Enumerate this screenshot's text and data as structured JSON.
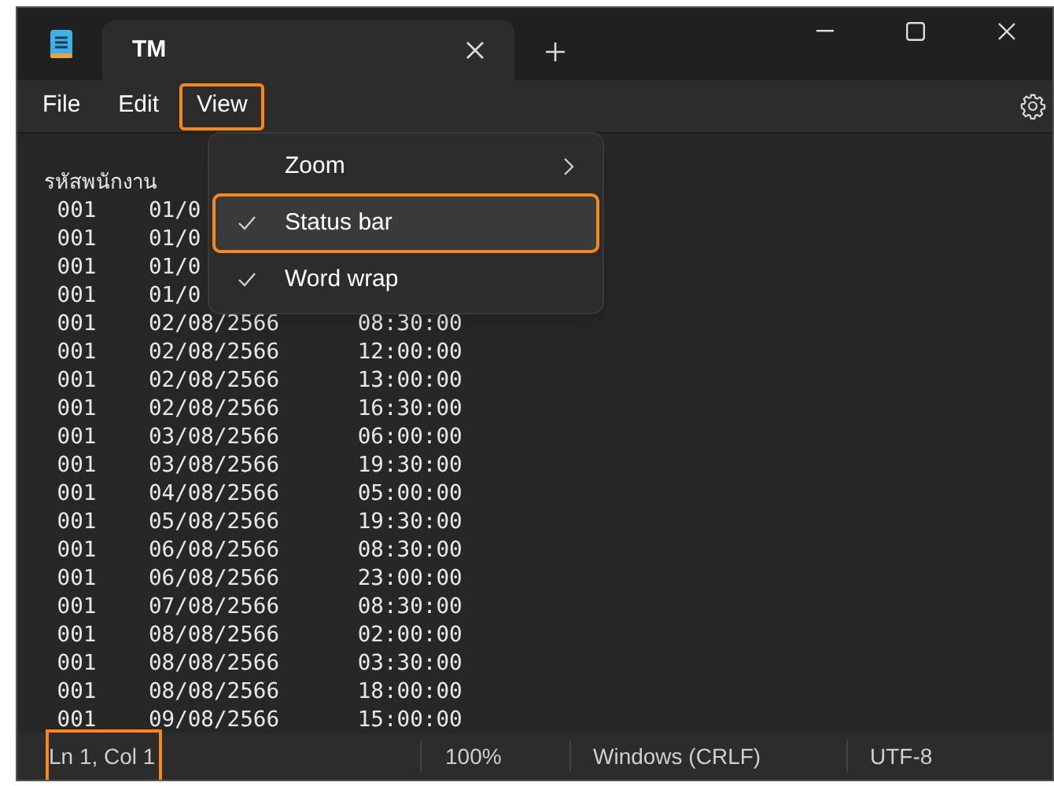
{
  "window": {
    "tab_title": "TM"
  },
  "menu_bar": [
    {
      "label": "File",
      "selected": false
    },
    {
      "label": "Edit",
      "selected": false
    },
    {
      "label": "View",
      "selected": true
    }
  ],
  "view_menu": [
    {
      "label": "Zoom",
      "kind": "submenu",
      "checked": false,
      "selected": false
    },
    {
      "label": "Status bar",
      "kind": "toggle",
      "checked": true,
      "selected": true
    },
    {
      "label": "Word wrap",
      "kind": "toggle",
      "checked": true,
      "selected": false
    }
  ],
  "editor_lines": [
    "รหัสพนักงาน",
    " 001    01/0",
    " 001    01/0",
    " 001    01/0",
    " 001    01/0",
    " 001    02/08/2566      08:30:00",
    " 001    02/08/2566      12:00:00",
    " 001    02/08/2566      13:00:00",
    " 001    02/08/2566      16:30:00",
    " 001    03/08/2566      06:00:00",
    " 001    03/08/2566      19:30:00",
    " 001    04/08/2566      05:00:00",
    " 001    05/08/2566      19:30:00",
    " 001    06/08/2566      08:30:00",
    " 001    06/08/2566      23:00:00",
    " 001    07/08/2566      08:30:00",
    " 001    08/08/2566      02:00:00",
    " 001    08/08/2566      03:30:00",
    " 001    08/08/2566      18:00:00",
    " 001    09/08/2566      15:00:00"
  ],
  "status_bar": [
    {
      "label": "Ln 1, Col 1",
      "selected": true
    },
    {
      "label": "100%",
      "selected": false
    },
    {
      "label": "Windows (CRLF)",
      "selected": false
    },
    {
      "label": "UTF-8",
      "selected": false
    }
  ]
}
